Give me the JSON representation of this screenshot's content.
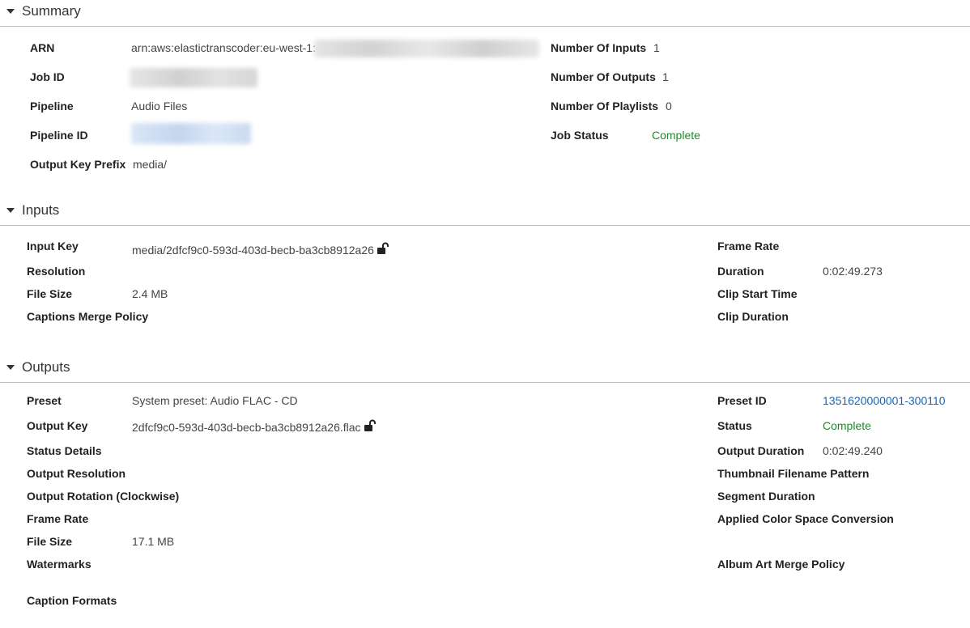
{
  "summary": {
    "title": "Summary",
    "arn_label": "ARN",
    "arn_value": "arn:aws:elastictranscoder:eu-west-1:",
    "job_id_label": "Job ID",
    "pipeline_label": "Pipeline",
    "pipeline_value": "Audio Files",
    "pipeline_id_label": "Pipeline ID",
    "output_key_prefix_label": "Output Key Prefix",
    "output_key_prefix_value": "media/",
    "num_inputs_label": "Number Of Inputs",
    "num_inputs_value": "1",
    "num_outputs_label": "Number Of Outputs",
    "num_outputs_value": "1",
    "num_playlists_label": "Number Of Playlists",
    "num_playlists_value": "0",
    "job_status_label": "Job Status",
    "job_status_value": "Complete"
  },
  "inputs": {
    "title": "Inputs",
    "input_key_label": "Input Key",
    "input_key_value": "media/2dfcf9c0-593d-403d-becb-ba3cb8912a26",
    "resolution_label": "Resolution",
    "file_size_label": "File Size",
    "file_size_value": "2.4 MB",
    "captions_merge_policy_label": "Captions Merge Policy",
    "frame_rate_label": "Frame Rate",
    "duration_label": "Duration",
    "duration_value": "0:02:49.273",
    "clip_start_time_label": "Clip Start Time",
    "clip_duration_label": "Clip Duration"
  },
  "outputs": {
    "title": "Outputs",
    "preset_label": "Preset",
    "preset_value": "System preset: Audio FLAC - CD",
    "output_key_label": "Output Key",
    "output_key_value": "2dfcf9c0-593d-403d-becb-ba3cb8912a26.flac",
    "status_details_label": "Status Details",
    "output_resolution_label": "Output Resolution",
    "output_rotation_label": "Output Rotation (Clockwise)",
    "frame_rate_label": "Frame Rate",
    "file_size_label": "File Size",
    "file_size_value": "17.1 MB",
    "watermarks_label": "Watermarks",
    "caption_formats_label": "Caption Formats",
    "preset_id_label": "Preset ID",
    "preset_id_value": "1351620000001-300110",
    "status_label": "Status",
    "status_value": "Complete",
    "output_duration_label": "Output Duration",
    "output_duration_value": "0:02:49.240",
    "thumbnail_pattern_label": "Thumbnail Filename Pattern",
    "segment_duration_label": "Segment Duration",
    "color_space_label": "Applied Color Space Conversion",
    "album_art_label": "Album Art Merge Policy"
  },
  "colors": {
    "status_complete": "#1d8a2b",
    "link": "#1166bb",
    "divider": "#bdbdbd"
  }
}
